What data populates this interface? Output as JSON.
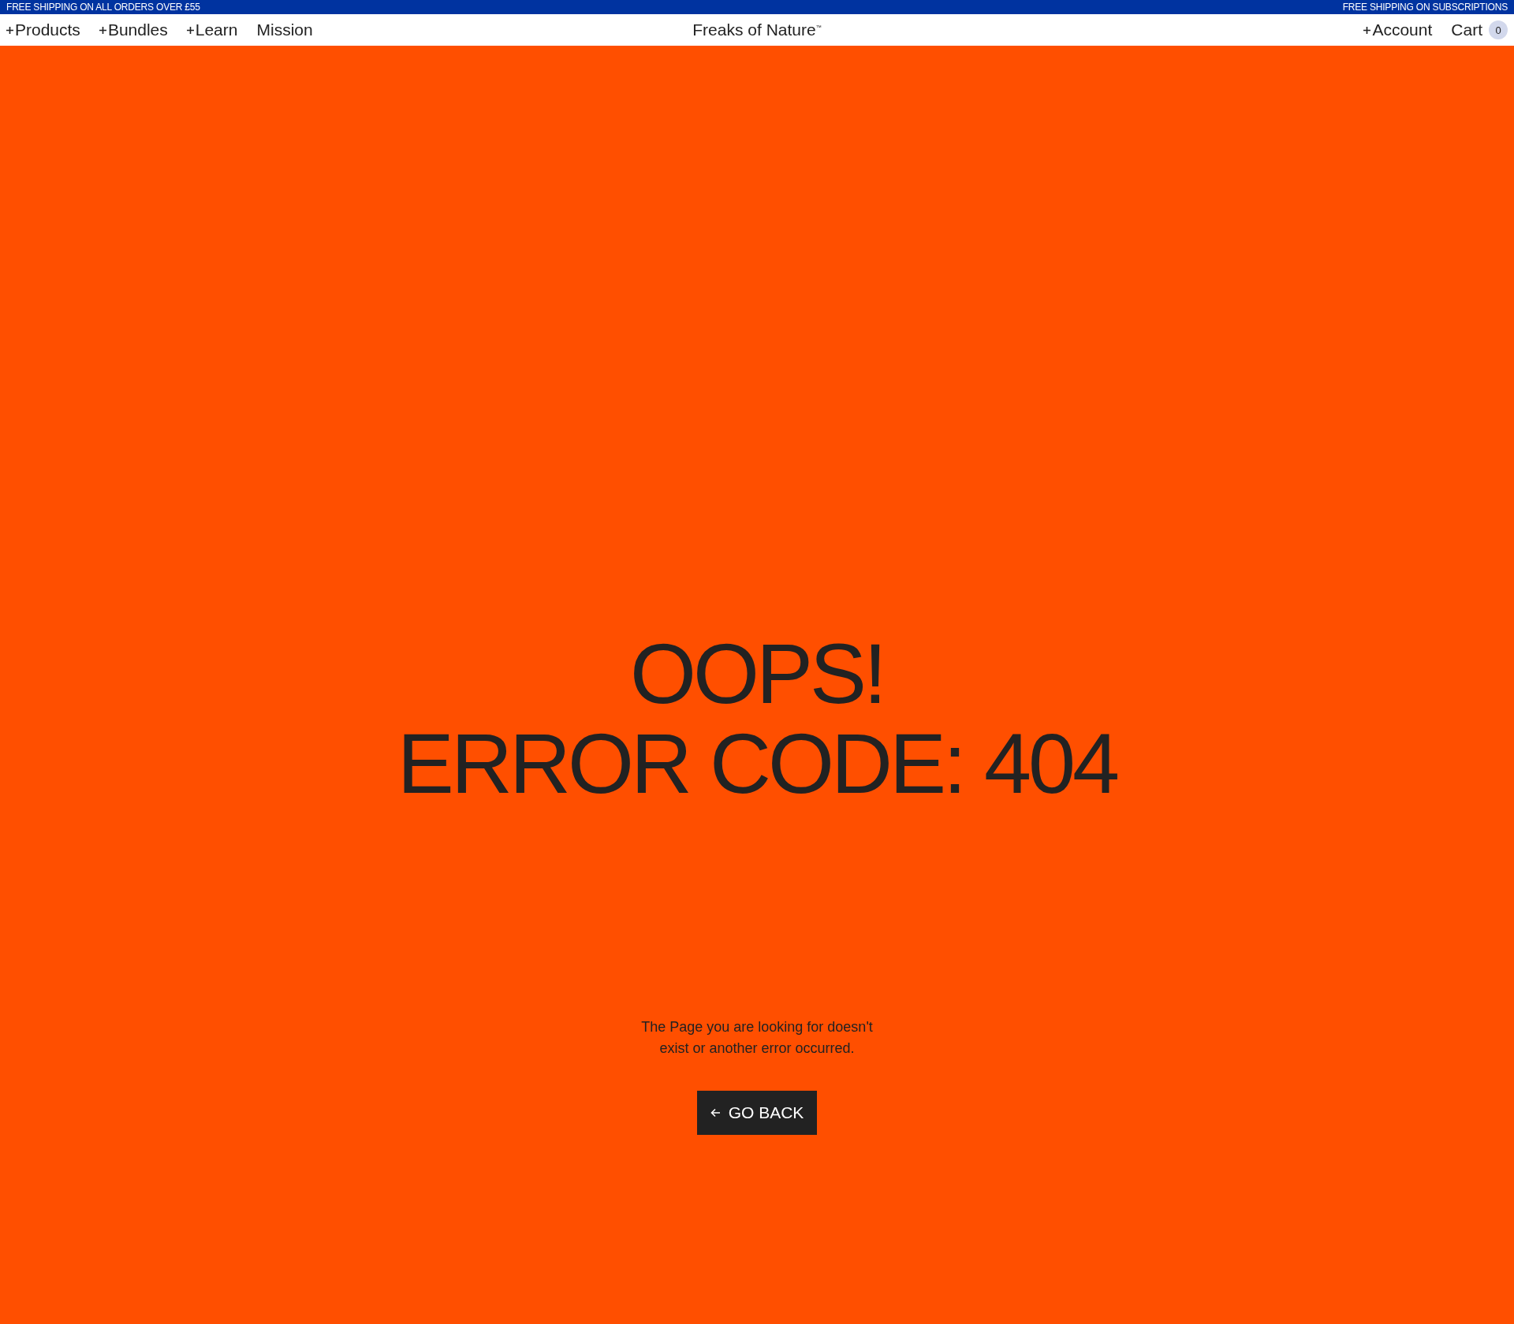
{
  "announcement_bar": {
    "left": "FREE SHIPPING ON ALL ORDERS OVER £55",
    "right": "FREE SHIPPING ON SUBSCRIPTIONS"
  },
  "nav": {
    "left_items": [
      {
        "label": "Products",
        "has_menu": true
      },
      {
        "label": "Bundles",
        "has_menu": true
      },
      {
        "label": "Learn",
        "has_menu": true
      },
      {
        "label": "Mission",
        "has_menu": false
      }
    ],
    "logo": {
      "text": "Freaks of Nature",
      "mark": "™"
    },
    "right_items": [
      {
        "label": "Account",
        "has_menu": true
      }
    ],
    "cart": {
      "label": "Cart",
      "count": "0"
    }
  },
  "error": {
    "title_lines": [
      "OOPS!",
      "ERROR CODE: 404"
    ],
    "message": "The Page you are looking for doesn't exist or another error occurred.",
    "button": "GO BACK"
  }
}
